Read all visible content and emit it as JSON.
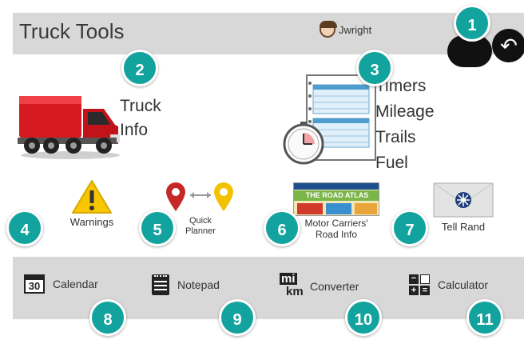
{
  "header": {
    "title": "Truck Tools",
    "user": "Jwright"
  },
  "main": {
    "truck_info": {
      "line1": "Truck",
      "line2": "Info"
    },
    "trip_log_items": [
      "Timers",
      "Mileage",
      "Trails",
      "Fuel"
    ]
  },
  "tools": {
    "warnings": "Warnings",
    "quick_planner_line1": "Quick",
    "quick_planner_line2": "Planner",
    "road_atlas_banner": "THE ROAD ATLAS",
    "road_info_line1": "Motor Carriers'",
    "road_info_line2": "Road Info",
    "tell_rand": "Tell Rand"
  },
  "footer": {
    "calendar_number": "30",
    "calendar": "Calendar",
    "notepad": "Notepad",
    "converter_top": "mi",
    "converter_bottom": "km",
    "converter": "Converter",
    "calculator": "Calculator"
  },
  "callouts": [
    "1",
    "2",
    "3",
    "4",
    "5",
    "6",
    "7",
    "8",
    "9",
    "10",
    "11"
  ],
  "colors": {
    "header_bg": "#d8d8d8",
    "callout": "#13a39e",
    "truck_red": "#d71920",
    "pin_red": "#c62828",
    "pin_yellow": "#f2c200",
    "warning_yellow": "#f7c600"
  },
  "icons": {
    "back": "back-arrow-icon",
    "user": "user-avatar-icon",
    "calendar": "calendar-icon",
    "notepad": "notepad-icon",
    "converter": "unit-converter-icon",
    "calculator": "calculator-icon"
  }
}
